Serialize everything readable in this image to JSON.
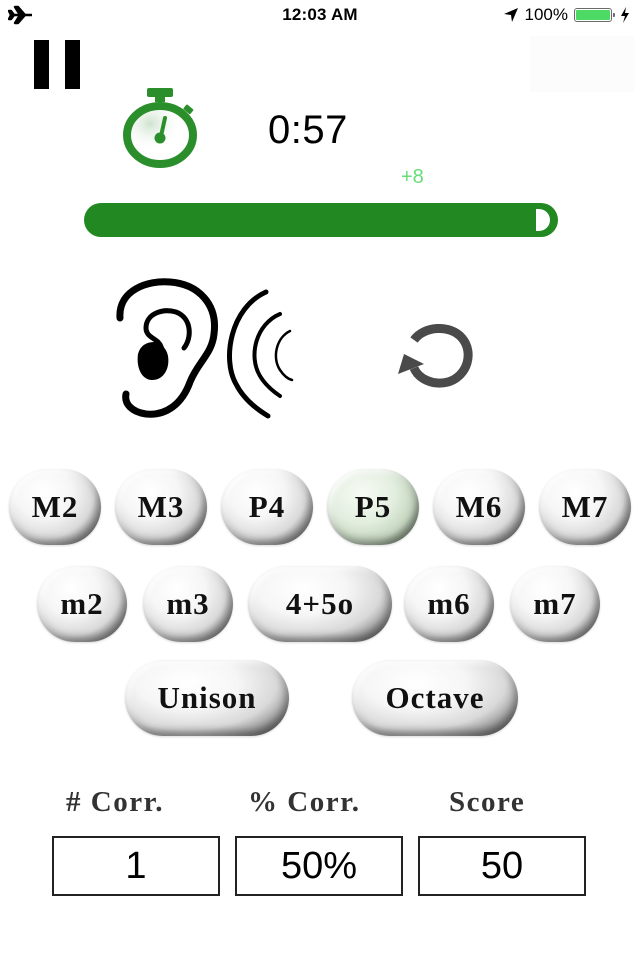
{
  "status_bar": {
    "time": "12:03 AM",
    "battery_text": "100%",
    "battery_level": 1.0,
    "battery_color": "#4cd964",
    "icons": [
      "airplane-icon",
      "location-arrow-icon",
      "battery-icon",
      "charging-bolt-icon"
    ]
  },
  "controls": {
    "pause_icon": "pause-icon",
    "replay_icon": "replay-icon",
    "listen_icon": "ear-sound-icon"
  },
  "timer": {
    "icon": "stopwatch-icon",
    "value": "0:57",
    "bonus": "+8",
    "progress_fraction": 0.97,
    "accent_color": "#228822",
    "bonus_color": "#66dd77"
  },
  "intervals": {
    "row1": [
      {
        "label": "M2",
        "selected": false
      },
      {
        "label": "M3",
        "selected": false
      },
      {
        "label": "P4",
        "selected": false
      },
      {
        "label": "P5",
        "selected": true
      },
      {
        "label": "M6",
        "selected": false
      },
      {
        "label": "M7",
        "selected": false
      }
    ],
    "row2": [
      {
        "label": "m2",
        "selected": false
      },
      {
        "label": "m3",
        "selected": false
      },
      {
        "label": "4+5o",
        "selected": false
      },
      {
        "label": "m6",
        "selected": false
      },
      {
        "label": "m7",
        "selected": false
      }
    ],
    "row3": [
      {
        "label": "Unison",
        "selected": false
      },
      {
        "label": "Octave",
        "selected": false
      }
    ]
  },
  "stats": {
    "correct_label": "# Corr.",
    "percent_label": "% Corr.",
    "score_label": "Score",
    "correct_value": "1",
    "percent_value": "50%",
    "score_value": "50"
  }
}
